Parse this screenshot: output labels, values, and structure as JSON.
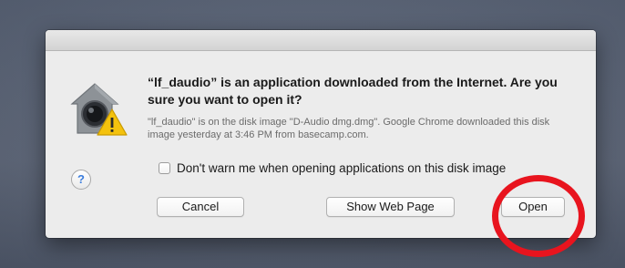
{
  "dialog": {
    "title": "“lf_daudio” is an application downloaded from the Internet. Are you sure you want to open it?",
    "detail": "\"lf_daudio\" is on the disk image \"D-Audio dmg.dmg\". Google Chrome downloaded this disk image yesterday at 3:46 PM from basecamp.com.",
    "checkbox_label": "Don't warn me when opening applications on this disk image",
    "checkbox_checked": false,
    "help_label": "?",
    "buttons": {
      "cancel": "Cancel",
      "show_web_page": "Show Web Page",
      "open": "Open"
    },
    "icon": "gatekeeper-warning-icon"
  },
  "colors": {
    "highlight": "#e8141e",
    "help_accent": "#3b7ddd",
    "warning_yellow": "#f4c20d"
  }
}
